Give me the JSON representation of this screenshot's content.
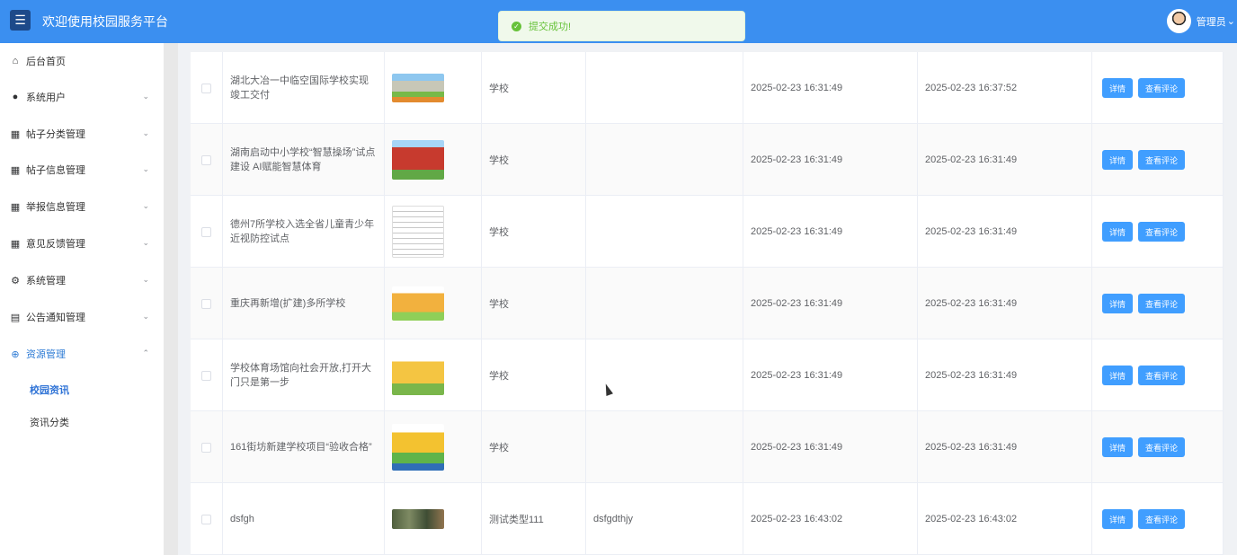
{
  "header": {
    "title": "欢迎使用校园服务平台",
    "menu_icon": "menu-icon",
    "user_name": "管理员",
    "user_caret": "⌄"
  },
  "toast": {
    "message": "提交成功!"
  },
  "sidebar": {
    "items": [
      {
        "label": "后台首页",
        "icon": "home-icon"
      },
      {
        "label": "系统用户",
        "icon": "user-icon"
      },
      {
        "label": "帖子分类管理",
        "icon": "grid-icon"
      },
      {
        "label": "帖子信息管理",
        "icon": "grid-icon"
      },
      {
        "label": "举报信息管理",
        "icon": "grid-icon"
      },
      {
        "label": "意见反馈管理",
        "icon": "grid-icon"
      },
      {
        "label": "系统管理",
        "icon": "gear-icon"
      },
      {
        "label": "公告通知管理",
        "icon": "document-icon"
      },
      {
        "label": "资源管理",
        "icon": "plus-circle-icon"
      }
    ],
    "sub_items": [
      {
        "label": "校园资讯",
        "active": true
      },
      {
        "label": "资讯分类",
        "active": false
      }
    ]
  },
  "table": {
    "rows": [
      {
        "title": "湖北大冶一中临空国际学校实现竣工交付",
        "type": "学校",
        "extra": "",
        "created": "2025-02-23 16:31:49",
        "updated": "2025-02-23 16:37:52",
        "detail": "详情",
        "comment": "查看评论",
        "thumb": "school-building-thumb"
      },
      {
        "title": "湖南启动中小学校“智慧操场”试点建设 AI赋能智慧体育",
        "type": "学校",
        "extra": "",
        "created": "2025-02-23 16:31:49",
        "updated": "2025-02-23 16:31:49",
        "detail": "详情",
        "comment": "查看评论",
        "thumb": "red-school-thumb"
      },
      {
        "title": "德州7所学校入选全省儿童青少年近视防控试点",
        "type": "学校",
        "extra": "",
        "created": "2025-02-23 16:31:49",
        "updated": "2025-02-23 16:31:49",
        "detail": "详情",
        "comment": "查看评论",
        "thumb": "school-list-thumb"
      },
      {
        "title": "重庆再新增(扩建)多所学校",
        "type": "学校",
        "extra": "",
        "created": "2025-02-23 16:31:49",
        "updated": "2025-02-23 16:31:49",
        "detail": "详情",
        "comment": "查看评论",
        "thumb": "cartoon-school-thumb"
      },
      {
        "title": "学校体育场馆向社会开放,打开大门只是第一步",
        "type": "学校",
        "extra": "",
        "created": "2025-02-23 16:31:49",
        "updated": "2025-02-23 16:31:49",
        "detail": "详情",
        "comment": "查看评论",
        "thumb": "yellow-school-thumb"
      },
      {
        "title": "161街坊新建学校项目“验收合格”",
        "type": "学校",
        "extra": "",
        "created": "2025-02-23 16:31:49",
        "updated": "2025-02-23 16:31:49",
        "detail": "详情",
        "comment": "查看评论",
        "thumb": "colorful-school-thumb"
      },
      {
        "title": "dsfgh",
        "type": "测试类型111",
        "extra": "dsfgdthjy",
        "created": "2025-02-23 16:43:02",
        "updated": "2025-02-23 16:43:02",
        "detail": "详情",
        "comment": "查看评论",
        "thumb": "landscape-thumb"
      }
    ]
  },
  "colors": {
    "header": "#3b8ff0",
    "primary": "#409eff",
    "success": "#67c23a",
    "active_text": "#2d7bd5"
  }
}
